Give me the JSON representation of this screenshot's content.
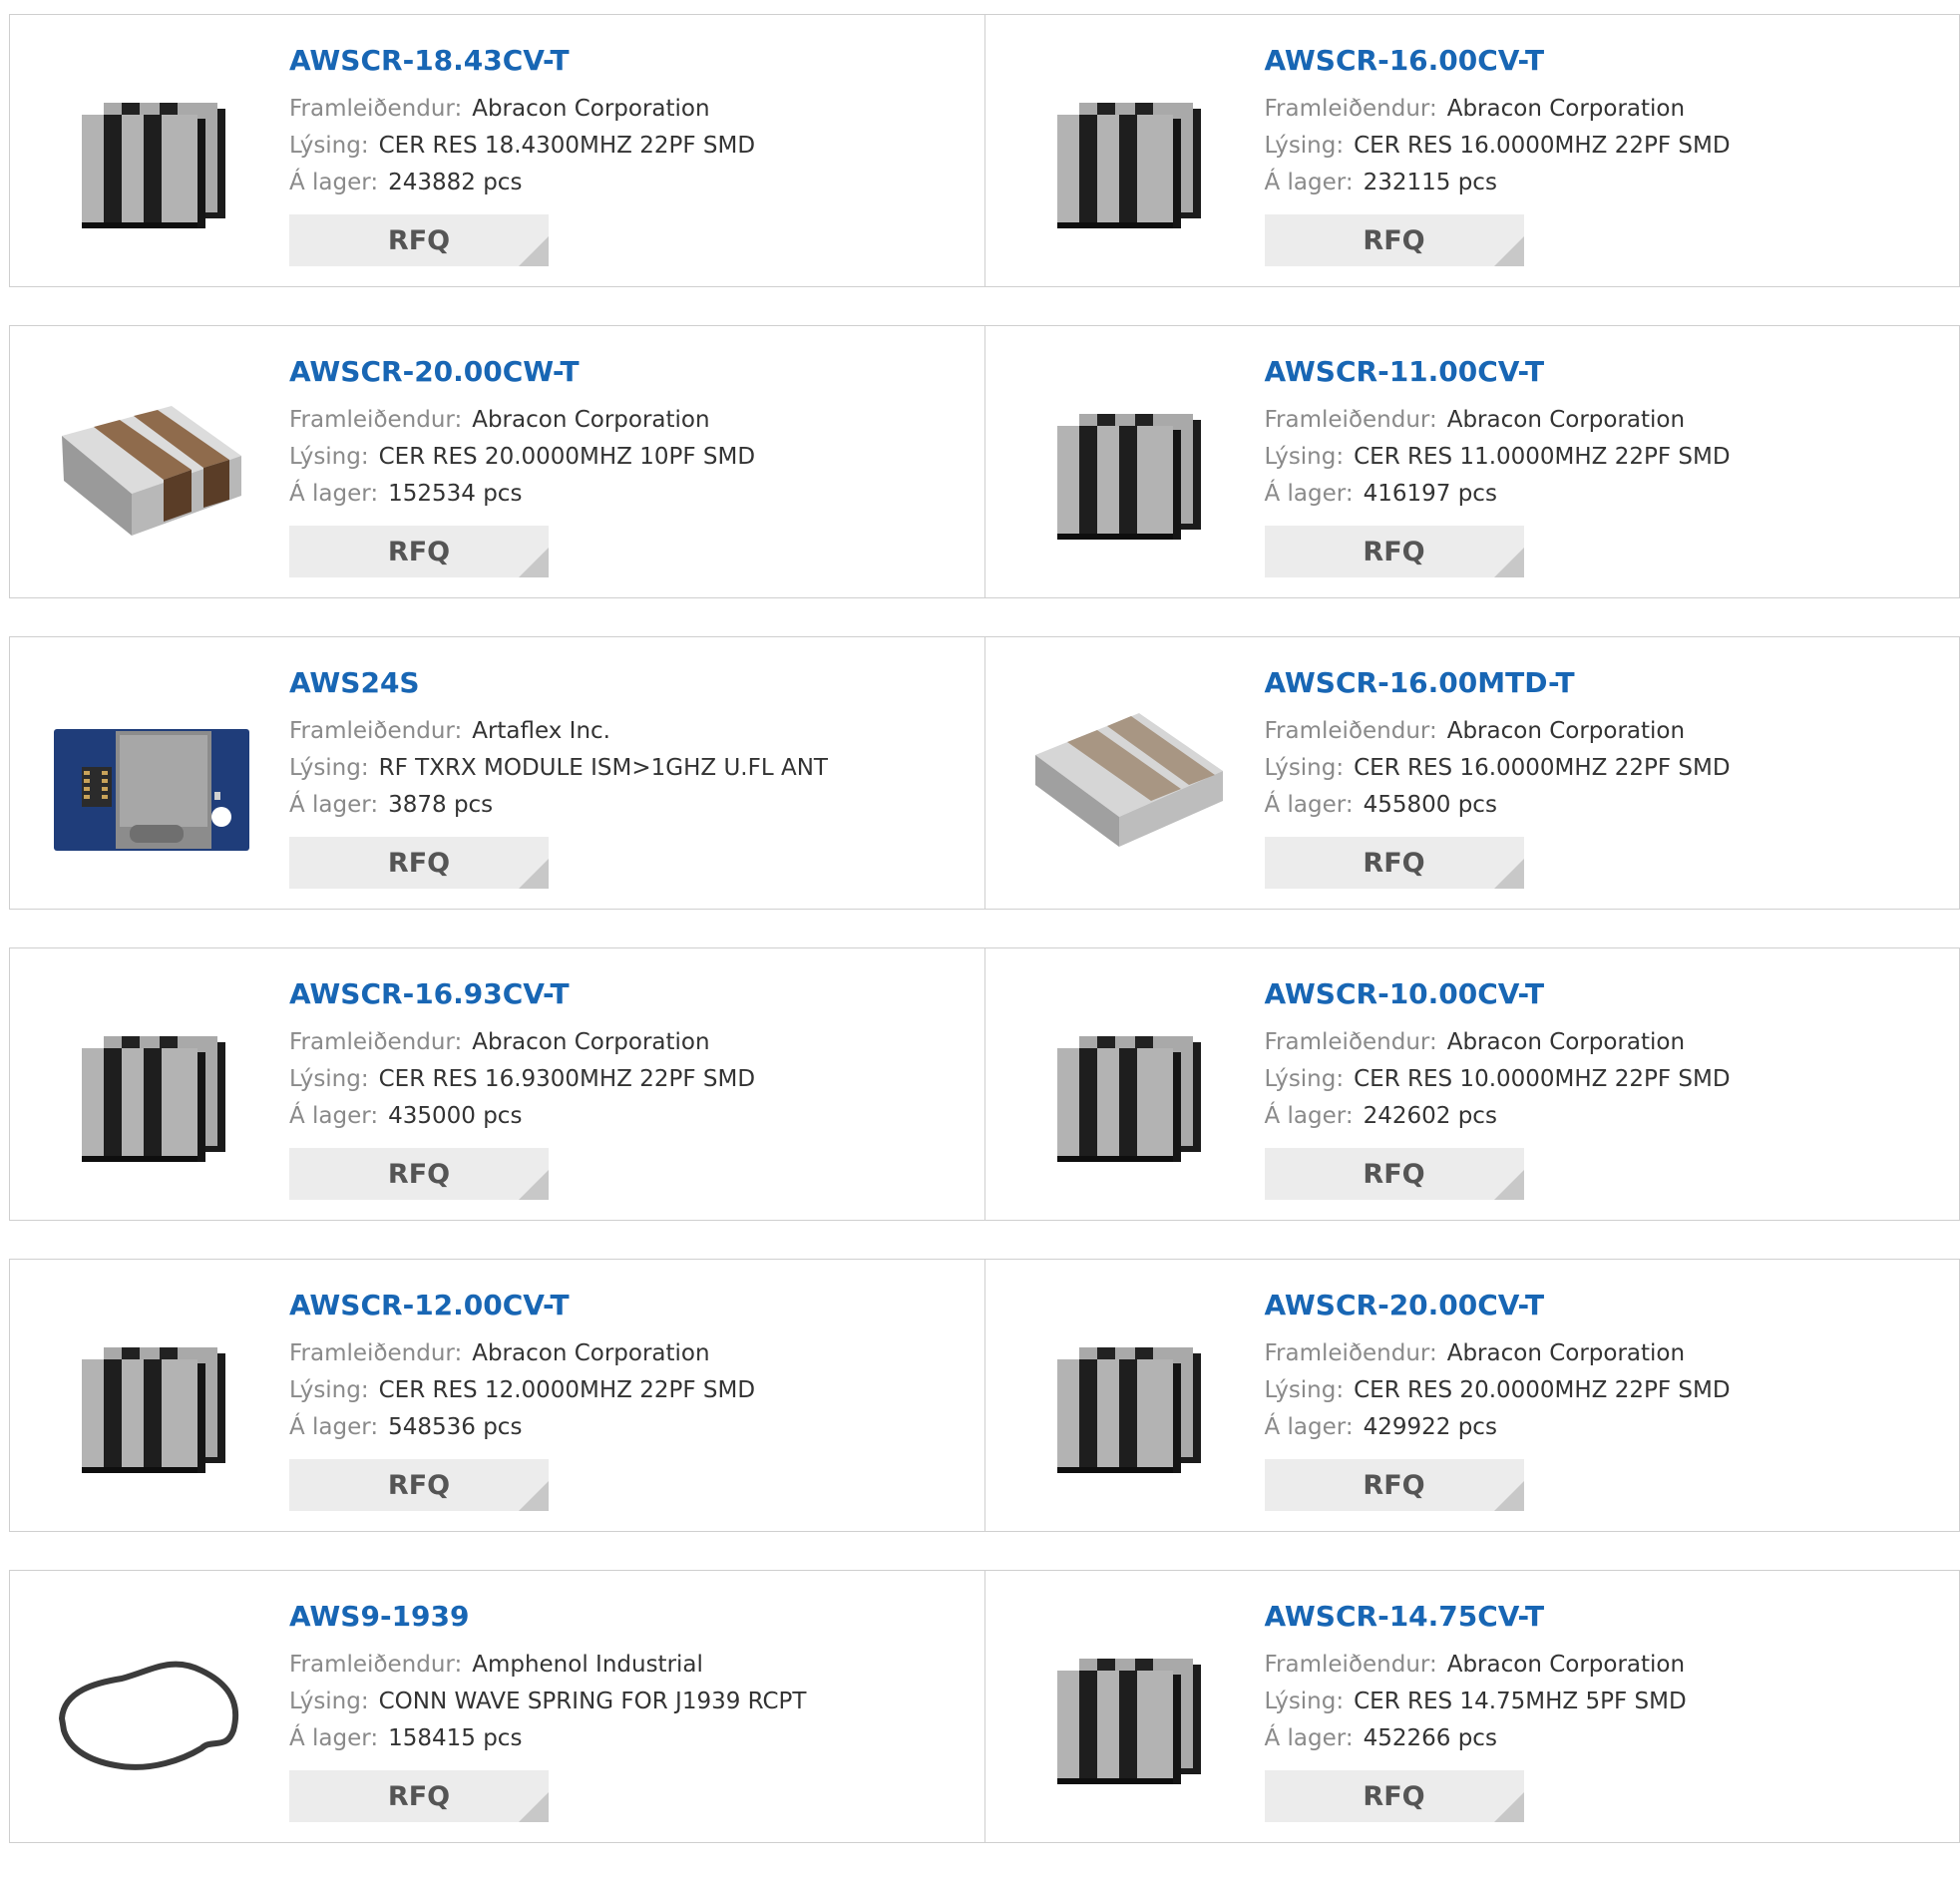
{
  "labels": {
    "manufacturer": "Framleiðendur:",
    "description": "Lýsing:",
    "stock": "Á lager:",
    "rfq": "RFQ"
  },
  "products": [
    {
      "pn": "AWSCR-18.43CV-T",
      "mfr": "Abracon Corporation",
      "desc": "CER RES 18.4300MHZ 22PF SMD",
      "stock": "243882 pcs",
      "img": "resonator-stack"
    },
    {
      "pn": "AWSCR-16.00CV-T",
      "mfr": "Abracon Corporation",
      "desc": "CER RES 16.0000MHZ 22PF SMD",
      "stock": "232115 pcs",
      "img": "resonator-stack"
    },
    {
      "pn": "AWSCR-20.00CW-T",
      "mfr": "Abracon Corporation",
      "desc": "CER RES 20.0000MHZ 10PF SMD",
      "stock": "152534 pcs",
      "img": "resonator-brown"
    },
    {
      "pn": "AWSCR-11.00CV-T",
      "mfr": "Abracon Corporation",
      "desc": "CER RES 11.0000MHZ 22PF SMD",
      "stock": "416197 pcs",
      "img": "resonator-stack"
    },
    {
      "pn": "AWS24S",
      "mfr": "Artaflex Inc.",
      "desc": "RF TXRX MODULE ISM>1GHZ U.FL ANT",
      "stock": "3878 pcs",
      "img": "rf-module"
    },
    {
      "pn": "AWSCR-16.00MTD-T",
      "mfr": "Abracon Corporation",
      "desc": "CER RES 16.0000MHZ 22PF SMD",
      "stock": "455800 pcs",
      "img": "resonator-gray"
    },
    {
      "pn": "AWSCR-16.93CV-T",
      "mfr": "Abracon Corporation",
      "desc": "CER RES 16.9300MHZ 22PF SMD",
      "stock": "435000 pcs",
      "img": "resonator-stack"
    },
    {
      "pn": "AWSCR-10.00CV-T",
      "mfr": "Abracon Corporation",
      "desc": "CER RES 10.0000MHZ 22PF SMD",
      "stock": "242602 pcs",
      "img": "resonator-stack"
    },
    {
      "pn": "AWSCR-12.00CV-T",
      "mfr": "Abracon Corporation",
      "desc": "CER RES 12.0000MHZ 22PF SMD",
      "stock": "548536 pcs",
      "img": "resonator-stack"
    },
    {
      "pn": "AWSCR-20.00CV-T",
      "mfr": "Abracon Corporation",
      "desc": "CER RES 20.0000MHZ 22PF SMD",
      "stock": "429922 pcs",
      "img": "resonator-stack"
    },
    {
      "pn": "AWS9-1939",
      "mfr": "Amphenol Industrial",
      "desc": "CONN WAVE SPRING FOR J1939 RCPT",
      "stock": "158415 pcs",
      "img": "wave-spring"
    },
    {
      "pn": "AWSCR-14.75CV-T",
      "mfr": "Abracon Corporation",
      "desc": "CER RES 14.75MHZ 5PF SMD",
      "stock": "452266 pcs",
      "img": "resonator-stack"
    }
  ]
}
